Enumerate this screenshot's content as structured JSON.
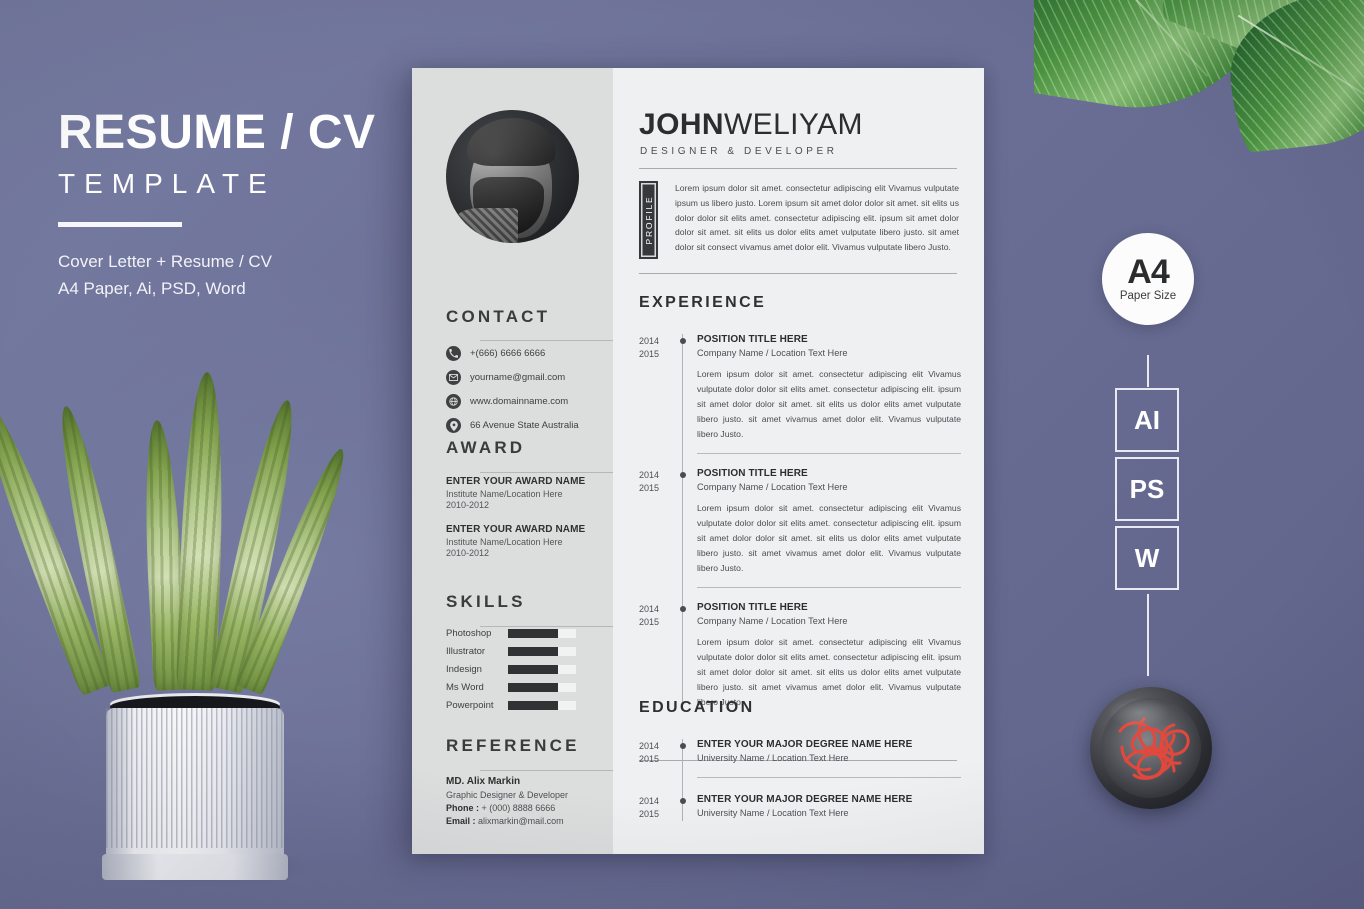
{
  "background": {
    "color": "#6a6e94"
  },
  "promo": {
    "title": "RESUME / CV",
    "subtitle": "TEMPLATE",
    "desc_line1": "Cover Letter + Resume / CV",
    "desc_line2": "A4 Paper, Ai, PSD, Word"
  },
  "format_badges": {
    "paper_size_code": "A4",
    "paper_size_label": "Paper Size",
    "items": [
      {
        "label": "AI"
      },
      {
        "label": "PS"
      },
      {
        "label": "W"
      }
    ]
  },
  "resume": {
    "header": {
      "first_name": "JOHN",
      "last_name": "WELIYAM",
      "role": "DESIGNER & DEVELOPER"
    },
    "profile": {
      "badge_label": "PROFILE",
      "text": "Lorem ipsum dolor sit amet. consectetur adipiscing elit Vivamus vulputate ipsum us  libero justo. Lorem ipsum sit amet dolor dolor sit amet. sit elits us dolor dolor sit elits amet. consectetur adipiscing elit. ipsum sit amet dolor dolor sit amet. sit elits us dolor elits amet vulputate libero justo. sit amet dolor sit consect vivamus amet dolor elit. Vivamus vulputate libero Justo."
    },
    "contact": {
      "heading": "CONTACT",
      "items": [
        {
          "icon": "phone-icon",
          "value": "+(666) 6666 6666"
        },
        {
          "icon": "email-icon",
          "value": "yourname@gmail.com"
        },
        {
          "icon": "globe-icon",
          "value": "www.domainname.com"
        },
        {
          "icon": "location-icon",
          "value": "66 Avenue State Australia"
        }
      ]
    },
    "award": {
      "heading": "AWARD",
      "items": [
        {
          "name": "ENTER YOUR AWARD NAME",
          "institute": "Institute Name/Location Here",
          "years": "2010-2012"
        },
        {
          "name": "ENTER YOUR AWARD NAME",
          "institute": "Institute Name/Location Here",
          "years": "2010-2012"
        }
      ]
    },
    "skills": {
      "heading": "SKILLS",
      "items": [
        {
          "name": "Photoshop",
          "level": 73
        },
        {
          "name": "Illustrator",
          "level": 73
        },
        {
          "name": "Indesign",
          "level": 73
        },
        {
          "name": "Ms Word",
          "level": 73
        },
        {
          "name": "Powerpoint",
          "level": 73
        }
      ]
    },
    "reference": {
      "heading": "REFERENCE",
      "name": "MD. Alix Markin",
      "role": "Graphic Designer & Developer",
      "phone_label": "Phone :",
      "phone_value": " + (000) 8888 6666",
      "email_label": "Email :",
      "email_value": " alixmarkin@mail.com"
    },
    "experience": {
      "heading": "EXPERIENCE",
      "items": [
        {
          "year_start": "2014",
          "year_end": "2015",
          "title": "POSITION TITLE HERE",
          "company": "Company Name / Location Text Here",
          "desc": "Lorem ipsum dolor sit amet. consectetur adipiscing elit Vivamus vulputate dolor dolor sit elits amet. consectetur adipiscing elit. ipsum sit amet dolor dolor sit amet. sit elits us dolor elits amet vulputate libero justo. sit amet vivamus amet dolor elit. Vivamus vulputate libero Justo."
        },
        {
          "year_start": "2014",
          "year_end": "2015",
          "title": "POSITION TITLE HERE",
          "company": "Company Name / Location Text Here",
          "desc": "Lorem ipsum dolor sit amet. consectetur adipiscing elit Vivamus vulputate dolor dolor sit elits amet. consectetur adipiscing elit. ipsum sit amet dolor dolor sit amet. sit elits us dolor elits amet vulputate libero justo. sit amet vivamus amet dolor elit. Vivamus vulputate libero Justo."
        },
        {
          "year_start": "2014",
          "year_end": "2015",
          "title": "POSITION TITLE HERE",
          "company": "Company Name / Location Text Here",
          "desc": "Lorem ipsum dolor sit amet. consectetur adipiscing elit Vivamus vulputate dolor dolor sit elits amet. consectetur adipiscing elit. ipsum sit amet dolor dolor sit amet. sit elits us dolor elits amet vulputate libero justo. sit amet vivamus amet dolor elit. Vivamus vulputate libero Justo."
        }
      ]
    },
    "education": {
      "heading": "EDUCATION",
      "items": [
        {
          "year_start": "2014",
          "year_end": "2015",
          "title": "ENTER YOUR MAJOR DEGREE NAME HERE",
          "school": "University Name / Location Text Here"
        },
        {
          "year_start": "2014",
          "year_end": "2015",
          "title": "ENTER YOUR MAJOR DEGREE NAME HERE",
          "school": "University Name / Location Text Here"
        }
      ]
    }
  },
  "decor": {
    "plant": "snake-plant-in-white-ribbed-pot",
    "leaves": "tropical-leaves-top-right",
    "bowl": "dark-bowl-with-red-paperclips",
    "portrait": "bearded-man-profile-photo"
  }
}
